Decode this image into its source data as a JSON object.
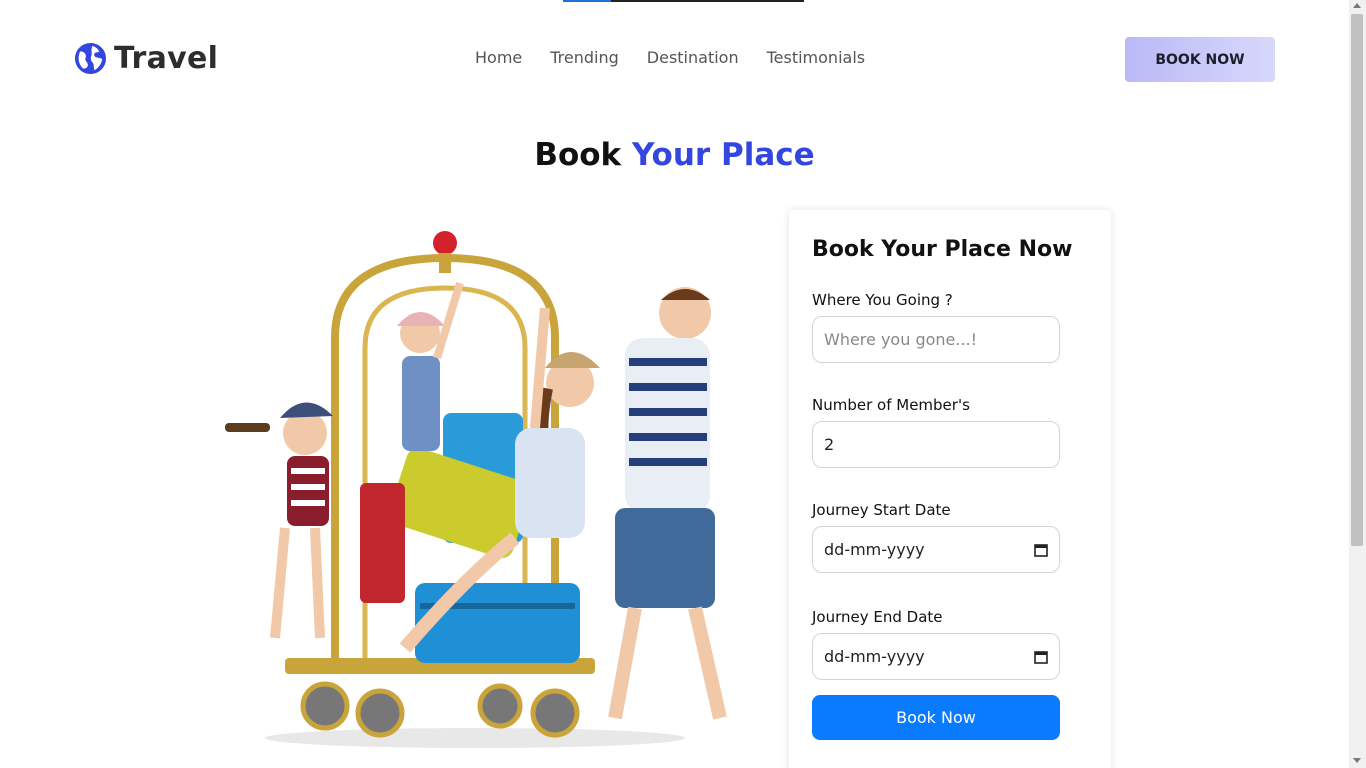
{
  "header": {
    "brand": "Travel",
    "brand_icon": "globe-icon",
    "nav": [
      "Home",
      "Trending",
      "Destination",
      "Testimonials"
    ],
    "cta_label": "BOOK NOW"
  },
  "section": {
    "title_part1": "Book",
    "title_part2": "Your Place",
    "title_accent_color": "#3346e0"
  },
  "form": {
    "title": "Book Your Place Now",
    "destination_label": "Where You Going ?",
    "destination_placeholder": "Where you gone...!",
    "members_label": "Number of Member's",
    "members_value": "2",
    "start_label": "Journey Start Date",
    "start_value": "dd-mm-yyyy",
    "end_label": "Journey End Date",
    "end_value": "dd-mm-yyyy",
    "submit_label": "Book Now",
    "submit_color": "#0a7bff"
  }
}
